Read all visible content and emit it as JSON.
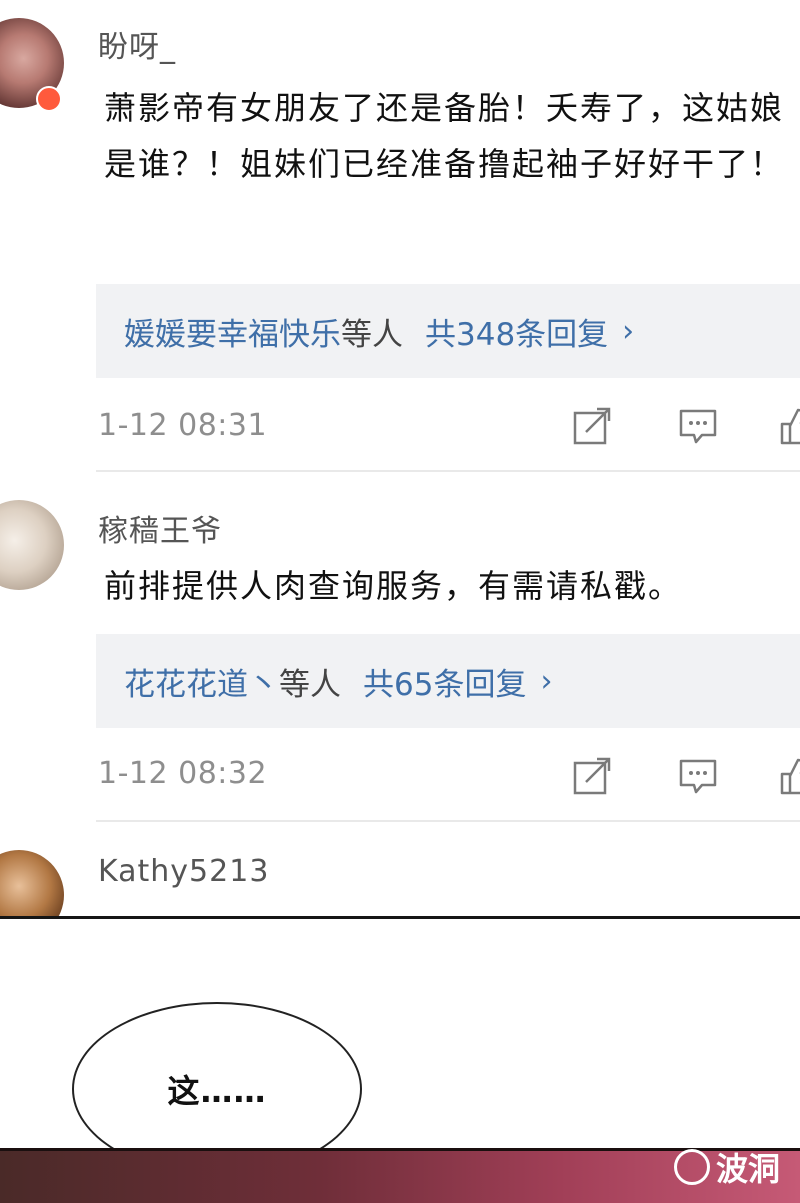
{
  "comments": [
    {
      "username": "盼呀_",
      "text": "萧影帝有女朋友了还是备胎！夭寿了，这姑娘是谁？！姐妹们已经准备撸起袖子好好干了！",
      "reply_users": "媛媛要幸福快乐",
      "reply_suffix": "等人",
      "reply_count": "共348条回复",
      "chevron": "›",
      "time": "1-12 08:31"
    },
    {
      "username": "稼穑王爷",
      "text": "前排提供人肉查询服务，有需请私戳。",
      "reply_users": "花花花道丶",
      "reply_suffix": "等人",
      "reply_count": "共65条回复",
      "chevron": "›",
      "time": "1-12 08:32"
    },
    {
      "username": "Kathy5213"
    }
  ],
  "icons": {
    "share": "share-icon",
    "reply": "comment-icon",
    "like": "like-icon"
  },
  "speech_bubble": {
    "text": "这……"
  },
  "watermark": {
    "text": "波洞"
  },
  "colors": {
    "link": "#3f6fa8",
    "reply_box_bg": "#f1f2f4",
    "meta_gray": "#8e8e8e"
  }
}
